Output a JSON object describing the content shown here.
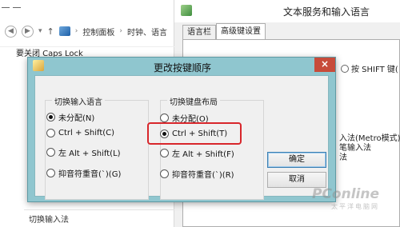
{
  "explorer": {
    "breadcrumb": [
      "控制面板",
      "时钟、语言"
    ],
    "bottom_label": "切换输入法"
  },
  "text_services": {
    "title": "文本服务和输入语言",
    "tabs": [
      "语言栏",
      "高级键设置"
    ],
    "active_tab": "高级键设置",
    "caps_lock_label": "要关闭 Caps Lock",
    "shift_option": "按 SHIFT 键(",
    "list_lines": [
      "入法(Metro模式)",
      "笔输入法",
      "法"
    ]
  },
  "dialog": {
    "title": "更改按键顺序",
    "close_glyph": "×",
    "input_language_group": {
      "legend": "切换输入语言",
      "options": [
        {
          "label": "未分配(N)",
          "checked": true
        },
        {
          "label": "Ctrl + Shift(C)",
          "checked": false
        },
        {
          "label": "左 Alt + Shift(L)",
          "checked": false
        },
        {
          "label": "抑音符重音(`)(G)",
          "checked": false
        }
      ]
    },
    "keyboard_layout_group": {
      "legend": "切换键盘布局",
      "options": [
        {
          "label": "未分配(O)",
          "checked": false
        },
        {
          "label": "Ctrl + Shift(T)",
          "checked": true
        },
        {
          "label": "左 Alt + Shift(F)",
          "checked": false
        },
        {
          "label": "抑音符重音(`)(R)",
          "checked": false
        }
      ]
    },
    "ok_label": "确定",
    "cancel_label": "取消",
    "highlight_color": "#d8262b"
  },
  "watermark": {
    "main": "PConline",
    "sub": "太平洋电脑网"
  }
}
